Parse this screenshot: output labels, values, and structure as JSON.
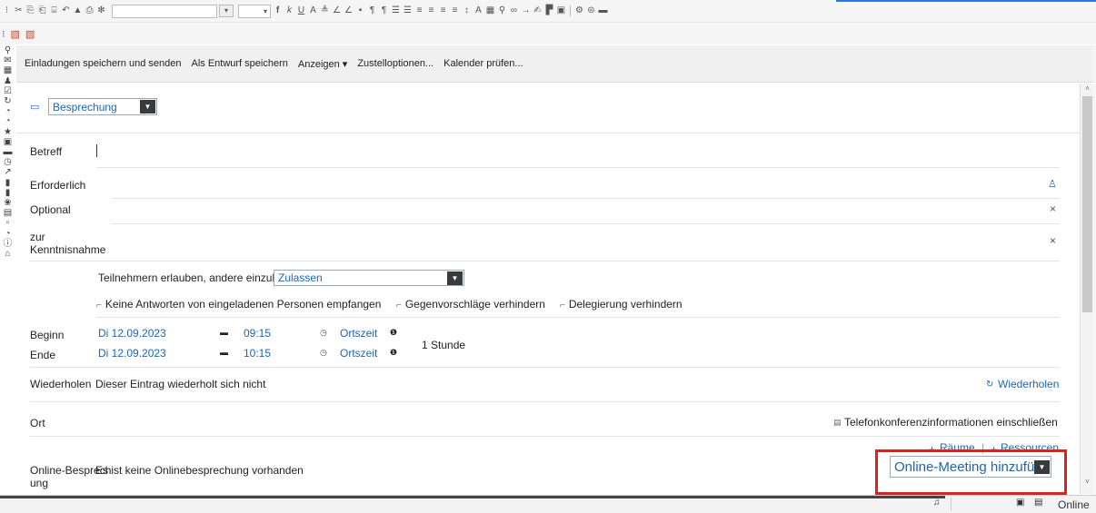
{
  "action_bar": {
    "items": [
      "Einladungen speichern und senden",
      "Als Entwurf speichern",
      "Anzeigen ▾",
      "Zustelloptionen...",
      "Kalender prüfen..."
    ]
  },
  "entry_type": {
    "value": "Besprechung"
  },
  "fields": {
    "subject_label": "Betreff",
    "required_label": "Erforderlich",
    "optional_label": "Optional",
    "fyi_label_line1": "zur",
    "fyi_label_line2": "Kenntnisnahme"
  },
  "invite": {
    "allow_label": "Teilnehmern erlauben, andere einzuladen",
    "allow_value": "Zulassen",
    "checkbox_no_replies": "Keine Antworten von eingeladenen Personen empfangen",
    "checkbox_no_counter": "Gegenvorschläge verhindern",
    "checkbox_no_delegation": "Delegierung verhindern"
  },
  "time": {
    "start_label": "Beginn",
    "end_label": "Ende",
    "start_date": "Di 12.09.2023",
    "end_date": "Di 12.09.2023",
    "start_time": "09:15",
    "end_time": "10:15",
    "timezone": "Ortszeit",
    "duration": "1 Stunde"
  },
  "repeat": {
    "label": "Wiederholen",
    "text": "Dieser Eintrag wiederholt sich nicht",
    "link": "Wiederholen"
  },
  "location": {
    "label": "Ort",
    "phone_conf": "Telefonkonferenzinformationen einschließen",
    "rooms_link": "Räume",
    "separator": "|",
    "resources_link": "Ressourcen"
  },
  "online": {
    "label_line1": "Online-Besprech",
    "label_line2": "ung",
    "text": "Es ist keine Onlinebesprechung vorhanden",
    "select_value": "Online-Meeting hinzufüg"
  },
  "status_bar": {
    "online": "Online"
  },
  "icons": {
    "cut": "✂",
    "copy": "⎘",
    "paste": "⎗",
    "undo": "↶",
    "redo": "↷",
    "calendar": "▭",
    "clock": "◷",
    "info": "❶",
    "repeat": "⟳",
    "person_add": "⚲",
    "close": "×",
    "bell": "🔔",
    "check": "☐",
    "arrow_down": "▼",
    "arrow_up": "˄",
    "arrow_dn_small": "˅",
    "plus": "+"
  }
}
